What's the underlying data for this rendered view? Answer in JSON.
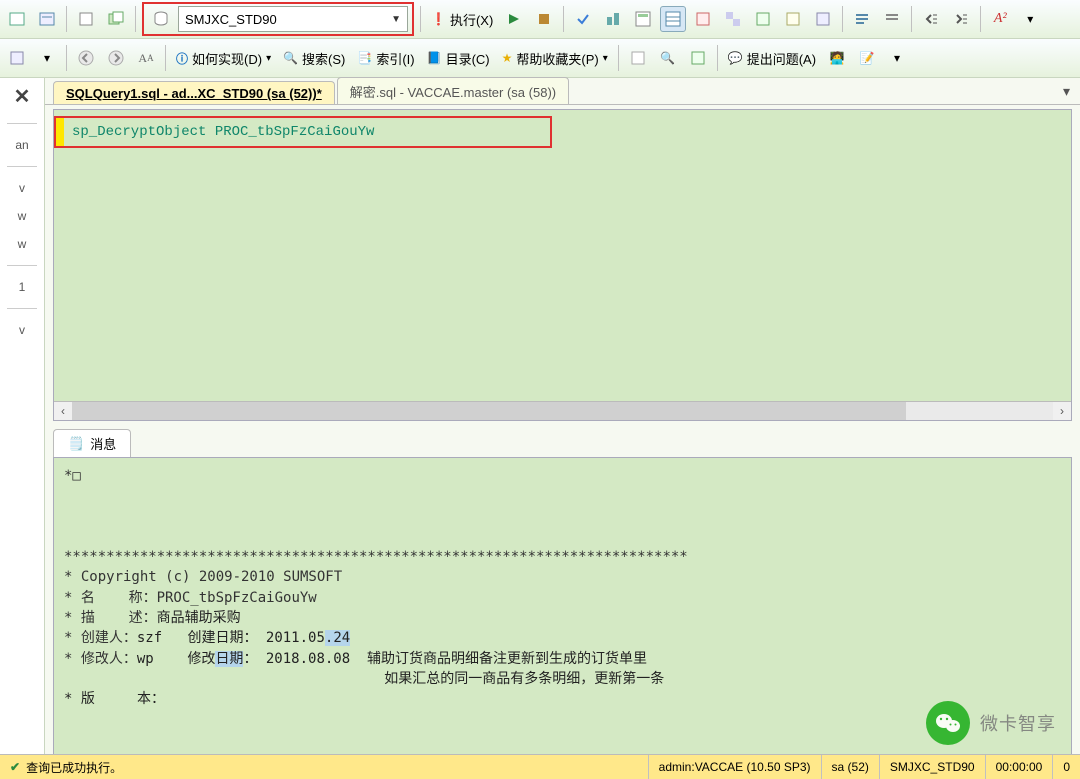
{
  "toolbar": {
    "database": "SMJXC_STD90",
    "execute_label": "执行(X)",
    "menu": {
      "howto": "如何实现(D)",
      "search": "搜索(S)",
      "index": "索引(I)",
      "catalog": "目录(C)",
      "favorites": "帮助收藏夹(P)",
      "ask_question": "提出问题(A)"
    }
  },
  "tabs": {
    "active": "SQLQuery1.sql - ad...XC_STD90 (sa (52))*",
    "inactive": "解密.sql - VACCAE.master (sa (58))"
  },
  "editor": {
    "code_line": "sp_DecryptObject PROC_tbSpFzCaiGouYw"
  },
  "messages": {
    "tab_label": "消息",
    "star_box": "*□",
    "divider": "**************************************************************************",
    "copyright": "* Copyright (c) 2009-2010 SUMSOFT",
    "name_lbl": "* 名    称：",
    "name_val": "PROC_tbSpFzCaiGouYw",
    "desc_lbl": "* 描    述：",
    "desc_val": "商品辅助采购",
    "creator_lbl": "* 创建人：",
    "creator_val": "szf",
    "create_date_lbl": "创建日期：",
    "create_date_val_prefix": "2011.05",
    "create_date_val_hl": ".24",
    "modifier_lbl": "* 修改人：",
    "modifier_val": "wp",
    "modify_date_lbl": "修改",
    "modify_date_lbl_hl": "日期",
    "modify_date_lbl_suffix": "：",
    "modify_date_val": "2018.08.08",
    "note1": "辅助订货商品明细备注更新到生成的订货单里",
    "note2": "如果汇总的同一商品有多条明细，更新第一条",
    "version_line": "* 版     本："
  },
  "status": {
    "success": "查询已成功执行。",
    "server": "admin:VACCAE (10.50 SP3)",
    "user": "sa (52)",
    "db": "SMJXC_STD90",
    "time": "00:00:00",
    "rows": "0"
  },
  "sidebar": {
    "items": [
      "an",
      "v",
      "w",
      "w",
      "1",
      "v"
    ]
  },
  "watermark": {
    "text": "微卡智享"
  }
}
